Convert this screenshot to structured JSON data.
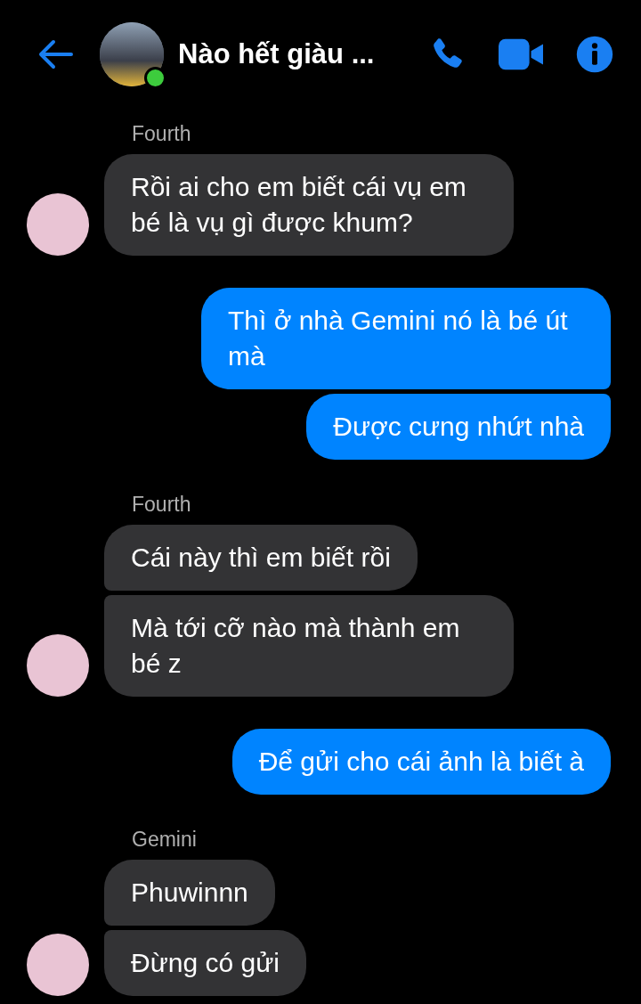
{
  "header": {
    "title": "Nào hết giàu ...",
    "online": true
  },
  "groups": [
    {
      "kind": "incoming",
      "sender": "Fourth",
      "bubbles": [
        "Rồi ai cho em biết cái vụ em bé là vụ gì được khum?"
      ]
    },
    {
      "kind": "outgoing",
      "bubbles": [
        "Thì ở nhà Gemini nó là bé út mà",
        "Được cưng nhứt nhà"
      ]
    },
    {
      "kind": "incoming",
      "sender": "Fourth",
      "bubbles": [
        "Cái này thì em biết rồi",
        "Mà tới cỡ nào mà thành em bé z"
      ]
    },
    {
      "kind": "outgoing",
      "bubbles": [
        "Để gửi cho cái ảnh là biết à"
      ]
    },
    {
      "kind": "incoming",
      "sender": "Gemini",
      "bubbles": [
        "Phuwinnn",
        "Đừng có gửi"
      ]
    }
  ]
}
